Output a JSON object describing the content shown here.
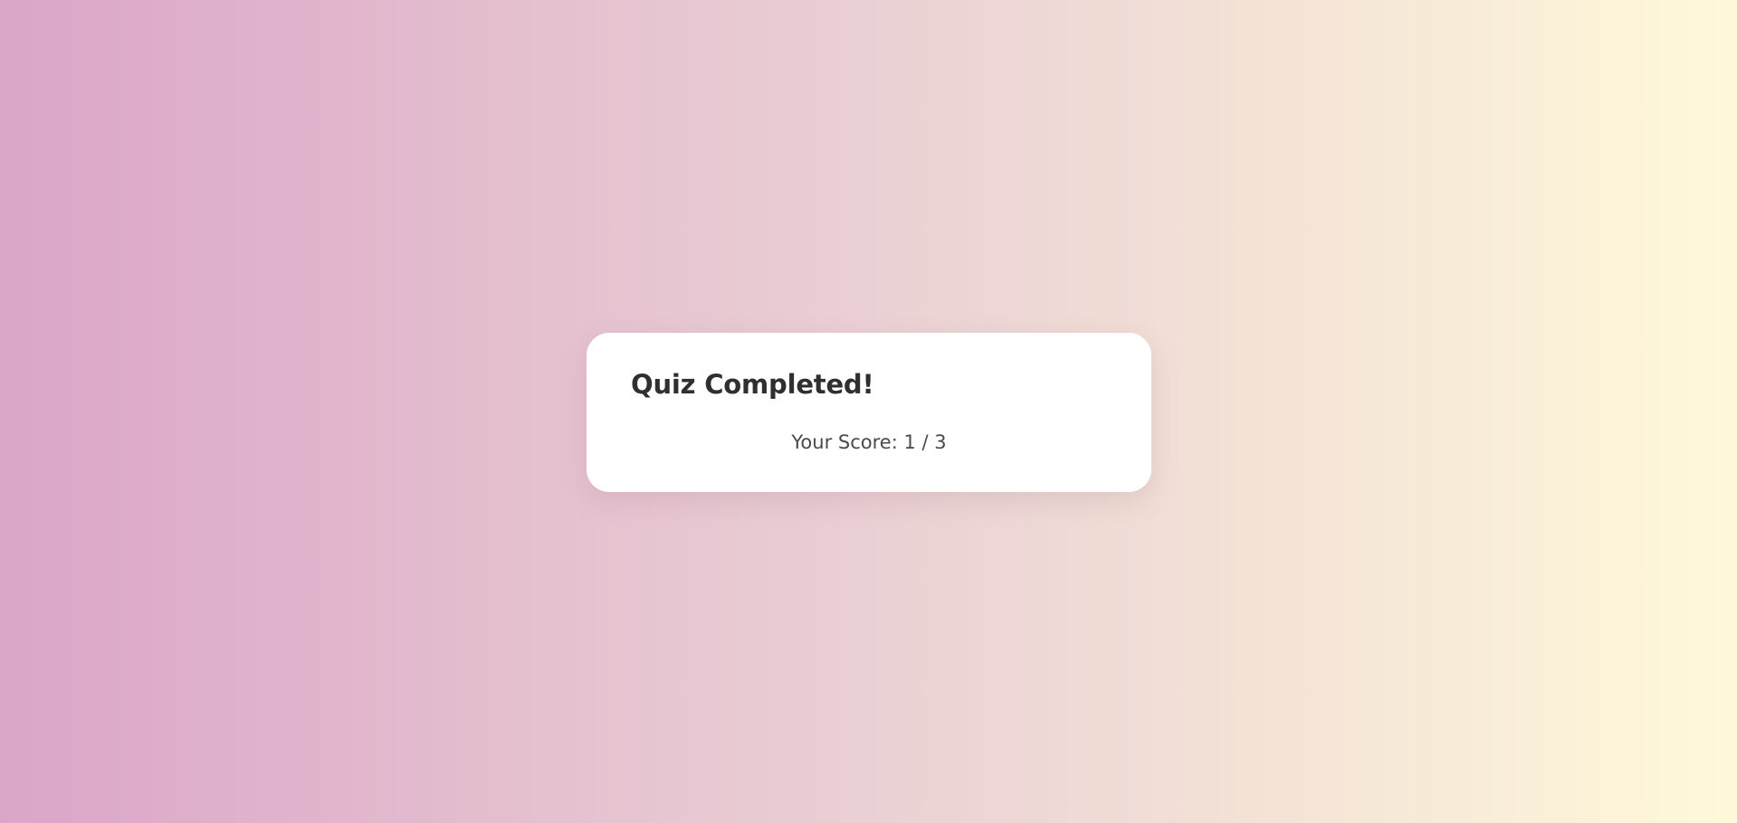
{
  "app": {
    "background_gradient": [
      "#dba5c8",
      "#ead0d4",
      "#fff9d9"
    ]
  },
  "result_card": {
    "title": "Quiz Completed!",
    "score_text": "Your Score: 1 / 3",
    "score": 1,
    "total": 3
  }
}
